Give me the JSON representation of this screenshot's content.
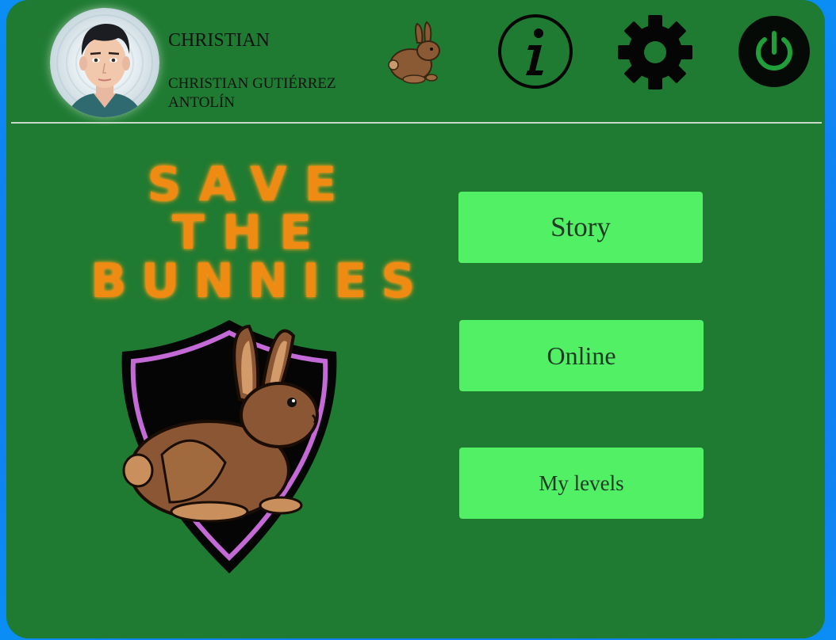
{
  "user": {
    "username": "CHRISTIAN",
    "full_name": "CHRISTIAN GUTIÉRREZ ANTOLÍN"
  },
  "header": {
    "icons": [
      "avatar",
      "bunny-icon",
      "info-icon",
      "gear-icon",
      "power-icon"
    ]
  },
  "logo": {
    "line1": "SAVE",
    "line2": "THE",
    "line3": "BUNNIES"
  },
  "menu": {
    "story_label": "Story",
    "online_label": "Online",
    "levels_label": "My levels"
  },
  "colors": {
    "background": "#1f7b32",
    "button": "#52f064",
    "logo_orange": "#ef8a12",
    "shield_border": "#c46ad6",
    "outer_blue": "#1478f0"
  }
}
